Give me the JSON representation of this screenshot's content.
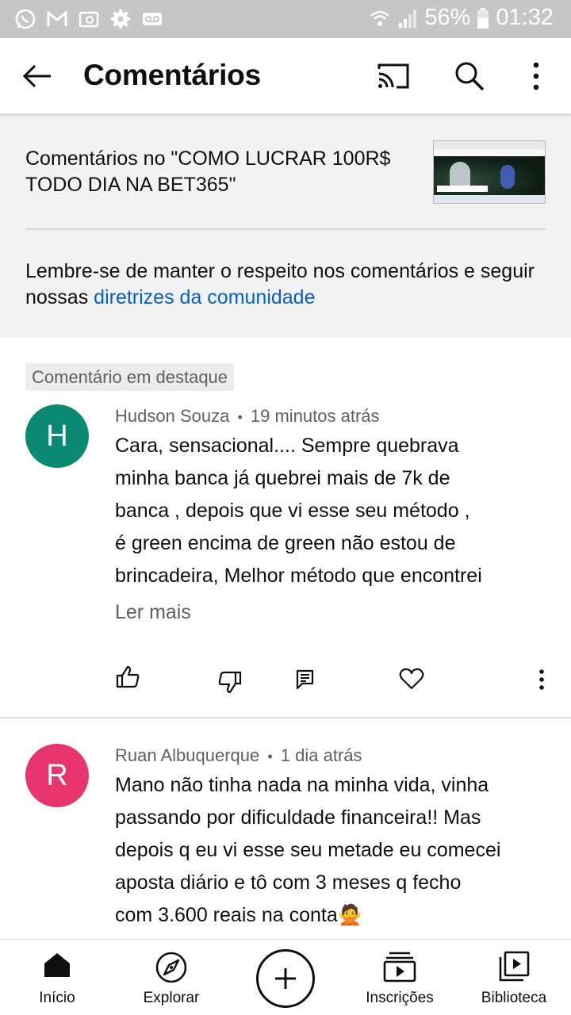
{
  "status_bar": {
    "battery": "56%",
    "time": "01:32",
    "icons": [
      "whatsapp-icon",
      "gmail-icon",
      "email-icon",
      "settings-icon",
      "voicemail-icon",
      "wifi-icon",
      "signal-icon",
      "battery-icon"
    ]
  },
  "app_bar": {
    "title": "Comentários",
    "icons": [
      "back-arrow-icon",
      "cast-icon",
      "search-icon",
      "more-vert-icon"
    ]
  },
  "header": {
    "video_title": "Comentários no \"COMO LUCRAR 100R$ TODO DIA NA BET365\"",
    "notice_text": "Lembre-se de manter o respeito nos comentários e seguir nossas ",
    "notice_link": "diretrizes da comunidade"
  },
  "comments": [
    {
      "badge": "Comentário em destaque",
      "avatar_letter": "H",
      "avatar_color": "#0b8a73",
      "author": "Hudson Souza",
      "separator": "•",
      "time": "19 minutos atrás",
      "lines": [
        "Cara, sensacional.... Sempre quebrava",
        "minha banca já quebrei mais de 7k de",
        "banca , depois que vi esse seu método ,",
        "é green encima de green não estou de",
        "brincadeira, Melhor método que encontrei"
      ],
      "read_more": "Ler mais",
      "actions": [
        "like-icon",
        "dislike-icon",
        "reply-icon",
        "heart-icon",
        "more-vert-icon"
      ]
    },
    {
      "avatar_letter": "R",
      "avatar_color": "#e8356d",
      "author": "Ruan Albuquerque",
      "separator": "•",
      "time": "1 dia atrás",
      "lines": [
        "Mano não tinha nada na minha vida, vinha",
        "passando por dificuldade financeira!! Mas",
        "depois q eu vi esse seu metade eu comecei",
        "aposta diário e tô com 3 meses q fecho",
        "com 3.600 reais na conta🙅"
      ]
    }
  ],
  "bottom_nav": {
    "items": [
      {
        "label": "Início",
        "icon": "home-icon"
      },
      {
        "label": "Explorar",
        "icon": "explore-icon"
      },
      {
        "label": "",
        "icon": "create-plus-icon"
      },
      {
        "label": "Inscrições",
        "icon": "subscriptions-icon"
      },
      {
        "label": "Biblioteca",
        "icon": "library-icon"
      }
    ]
  }
}
